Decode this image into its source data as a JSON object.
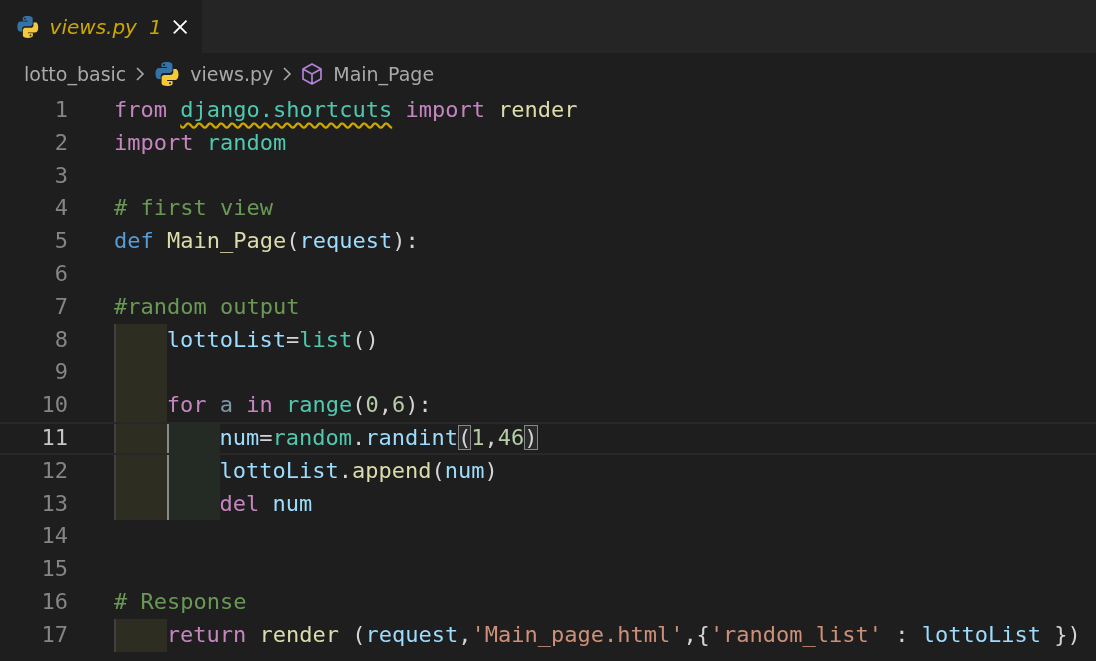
{
  "tab": {
    "label": "views.py",
    "problems": "1",
    "selected": true
  },
  "breadcrumbs": [
    {
      "text": "lotto_basic",
      "kind": "folder"
    },
    {
      "text": "views.py",
      "kind": "file"
    },
    {
      "text": "Main_Page",
      "kind": "symbol"
    }
  ],
  "lines": [
    {
      "number": "1",
      "current": false,
      "tokens": [
        {
          "text": "from ",
          "kind": "keyword"
        },
        {
          "text": "django.shortcuts",
          "kind": "module",
          "warning": true
        },
        {
          "text": " import ",
          "kind": "keyword"
        },
        {
          "text": "render",
          "kind": "func"
        }
      ]
    },
    {
      "number": "2",
      "current": false,
      "tokens": [
        {
          "text": "import ",
          "kind": "keyword"
        },
        {
          "text": "random",
          "kind": "module"
        }
      ]
    },
    {
      "number": "3",
      "current": false
    },
    {
      "number": "4",
      "current": false,
      "tokens": [
        {
          "text": "# first view",
          "kind": "comment"
        }
      ]
    },
    {
      "number": "5",
      "current": false,
      "tokens": [
        {
          "text": "def ",
          "kind": "storage"
        },
        {
          "text": "Main_Page",
          "kind": "func"
        },
        {
          "text": "(",
          "kind": "plain"
        },
        {
          "text": "request",
          "kind": "variable"
        },
        {
          "text": "):",
          "kind": "plain"
        }
      ]
    },
    {
      "number": "6",
      "current": false
    },
    {
      "number": "7",
      "current": false,
      "tokens": [
        {
          "text": "#random output",
          "kind": "comment"
        }
      ]
    },
    {
      "number": "8",
      "current": false,
      "guides": [
        {
          "kind": "outer"
        }
      ],
      "tokens": [
        {
          "text": "lottoList",
          "kind": "variable"
        },
        {
          "text": "=",
          "kind": "plain"
        },
        {
          "text": "list",
          "kind": "module"
        },
        {
          "text": "()",
          "kind": "plain"
        }
      ]
    },
    {
      "number": "9",
      "current": false,
      "guides": [
        {
          "kind": "outer"
        }
      ]
    },
    {
      "number": "10",
      "current": false,
      "guides": [
        {
          "kind": "outer"
        }
      ],
      "tokens": [
        {
          "text": "for ",
          "kind": "keyword"
        },
        {
          "text": "a",
          "kind": "dimmed"
        },
        {
          "text": " in ",
          "kind": "keyword"
        },
        {
          "text": "range",
          "kind": "module"
        },
        {
          "text": "(",
          "kind": "plain"
        },
        {
          "text": "0",
          "kind": "number"
        },
        {
          "text": ",",
          "kind": "plain"
        },
        {
          "text": "6",
          "kind": "number"
        },
        {
          "text": "):",
          "kind": "plain"
        }
      ]
    },
    {
      "number": "11",
      "current": true,
      "guides": [
        {
          "kind": "outer"
        },
        {
          "kind": "inner"
        }
      ],
      "tokens": [
        {
          "text": "num",
          "kind": "variable"
        },
        {
          "text": "=",
          "kind": "plain"
        },
        {
          "text": "random",
          "kind": "module"
        },
        {
          "text": ".",
          "kind": "plain"
        },
        {
          "text": "randint",
          "kind": "variable"
        },
        {
          "text": "(",
          "kind": "match"
        },
        {
          "text": "1",
          "kind": "number"
        },
        {
          "text": ",",
          "kind": "plain"
        },
        {
          "text": "46",
          "kind": "number"
        },
        {
          "text": ")",
          "kind": "match"
        }
      ]
    },
    {
      "number": "12",
      "current": false,
      "guides": [
        {
          "kind": "outer"
        },
        {
          "kind": "inner"
        }
      ],
      "tokens": [
        {
          "text": "lottoList",
          "kind": "variable"
        },
        {
          "text": ".",
          "kind": "plain"
        },
        {
          "text": "append",
          "kind": "func"
        },
        {
          "text": "(",
          "kind": "plain"
        },
        {
          "text": "num",
          "kind": "variable"
        },
        {
          "text": ")",
          "kind": "plain"
        }
      ]
    },
    {
      "number": "13",
      "current": false,
      "guides": [
        {
          "kind": "outer"
        },
        {
          "kind": "inner"
        }
      ],
      "tokens": [
        {
          "text": "del ",
          "kind": "keyword"
        },
        {
          "text": "num",
          "kind": "variable"
        }
      ]
    },
    {
      "number": "14",
      "current": false
    },
    {
      "number": "15",
      "current": false
    },
    {
      "number": "16",
      "current": false,
      "tokens": [
        {
          "text": "# Response",
          "kind": "comment"
        }
      ]
    },
    {
      "number": "17",
      "current": false,
      "guides": [
        {
          "kind": "outer"
        }
      ],
      "tokens": [
        {
          "text": "return ",
          "kind": "keyword"
        },
        {
          "text": "render ",
          "kind": "func"
        },
        {
          "text": "(",
          "kind": "plain"
        },
        {
          "text": "request",
          "kind": "variable"
        },
        {
          "text": ",",
          "kind": "plain"
        },
        {
          "text": "'Main_page.html'",
          "kind": "string"
        },
        {
          "text": ",{",
          "kind": "plain"
        },
        {
          "text": "'random_list'",
          "kind": "string"
        },
        {
          "text": " : ",
          "kind": "plain"
        },
        {
          "text": "lottoList",
          "kind": "variable"
        },
        {
          "text": " })",
          "kind": "plain"
        }
      ]
    }
  ]
}
